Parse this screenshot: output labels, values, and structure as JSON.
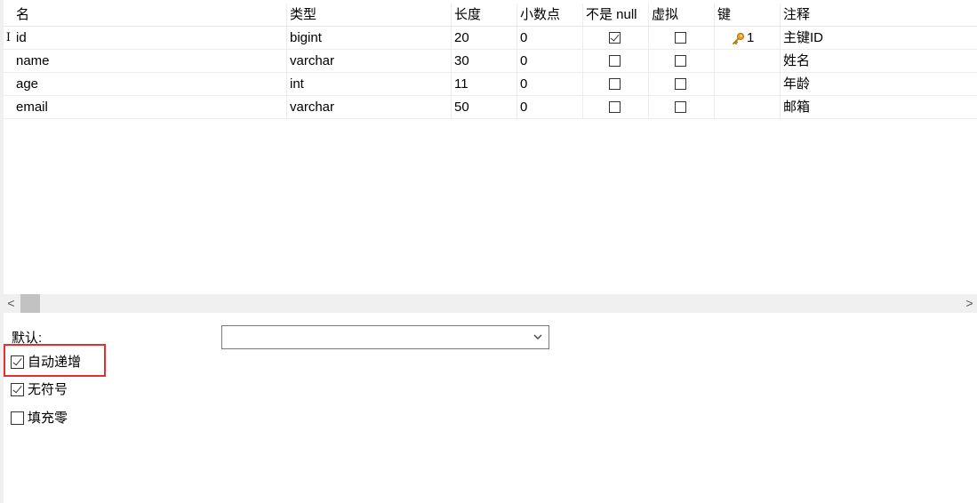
{
  "columns": [
    "名",
    "类型",
    "长度",
    "小数点",
    "不是 null",
    "虚拟",
    "键",
    "注释"
  ],
  "row_indicator": "I",
  "rows": [
    {
      "name": "id",
      "type": "bigint",
      "length": "20",
      "decimals": "0",
      "not_null": true,
      "virtual": false,
      "key": "1",
      "comment": "主键ID"
    },
    {
      "name": "name",
      "type": "varchar",
      "length": "30",
      "decimals": "0",
      "not_null": false,
      "virtual": false,
      "key": "",
      "comment": "姓名"
    },
    {
      "name": "age",
      "type": "int",
      "length": "11",
      "decimals": "0",
      "not_null": false,
      "virtual": false,
      "key": "",
      "comment": "年龄"
    },
    {
      "name": "email",
      "type": "varchar",
      "length": "50",
      "decimals": "0",
      "not_null": false,
      "virtual": false,
      "key": "",
      "comment": "邮箱"
    }
  ],
  "scrollbar": {
    "left_arrow": "<",
    "right_arrow": ">"
  },
  "field_props": {
    "default_label": "默认:",
    "default_value": "",
    "options": [
      {
        "label": "自动递增",
        "checked": true
      },
      {
        "label": "无符号",
        "checked": true
      },
      {
        "label": "填充零",
        "checked": false
      }
    ]
  },
  "colors": {
    "highlight": "#e03030",
    "key_icon": "#e8a317"
  }
}
